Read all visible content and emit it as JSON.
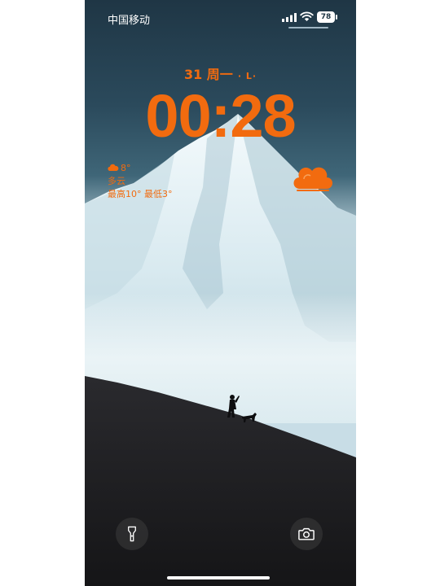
{
  "status_bar": {
    "carrier": "中国移动",
    "battery": "78",
    "signal_icon": "cellular-signal-icon",
    "wifi_icon": "wifi-icon"
  },
  "lockscreen": {
    "date": "31 周一",
    "lunar": "· L·",
    "time": "00:28"
  },
  "weather": {
    "temperature": "8°",
    "condition": "多云",
    "range": "最高10° 最低3°",
    "icon": "cloud-icon"
  },
  "buttons": {
    "flashlight_icon": "flashlight-icon",
    "camera_icon": "camera-icon"
  },
  "colors": {
    "accent": "#f26b0f",
    "sky_top": "#1f3645",
    "snow": "#e8f3f7",
    "slope": "#1d1d20"
  }
}
